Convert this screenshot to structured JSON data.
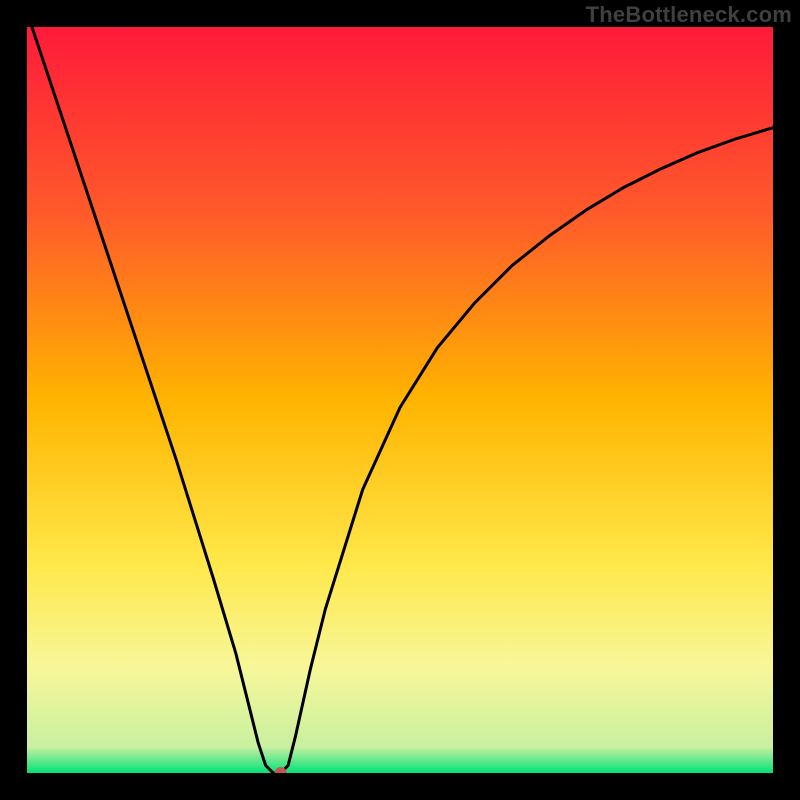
{
  "watermark": "TheBottleneck.com",
  "chart_data": {
    "type": "line",
    "title": "",
    "xlabel": "",
    "ylabel": "",
    "xlim": [
      0,
      100
    ],
    "ylim": [
      0,
      100
    ],
    "gradient_stops": [
      {
        "offset": 0.0,
        "color": "#ff1a3a"
      },
      {
        "offset": 0.25,
        "color": "#ff5a2a"
      },
      {
        "offset": 0.5,
        "color": "#ffb400"
      },
      {
        "offset": 0.72,
        "color": "#ffe84a"
      },
      {
        "offset": 0.86,
        "color": "#f7f79a"
      },
      {
        "offset": 0.965,
        "color": "#c9f0a0"
      },
      {
        "offset": 1.0,
        "color": "#00e27a"
      }
    ],
    "series": [
      {
        "name": "curve",
        "x": [
          0,
          5,
          10,
          15,
          20,
          25,
          28,
          30,
          31,
          32,
          33,
          34,
          35,
          36,
          38,
          40,
          45,
          50,
          55,
          60,
          65,
          70,
          75,
          80,
          85,
          90,
          95,
          100
        ],
        "values": [
          102,
          87,
          72,
          57,
          42,
          26,
          16,
          8,
          4,
          1,
          0,
          0,
          1,
          5,
          14,
          22,
          38,
          49,
          57,
          63,
          68,
          72,
          75.5,
          78.5,
          81,
          83.2,
          85,
          86.5
        ]
      }
    ],
    "marker": {
      "x": 34,
      "y": 0,
      "color": "#c65454",
      "radius_px": 6
    }
  }
}
